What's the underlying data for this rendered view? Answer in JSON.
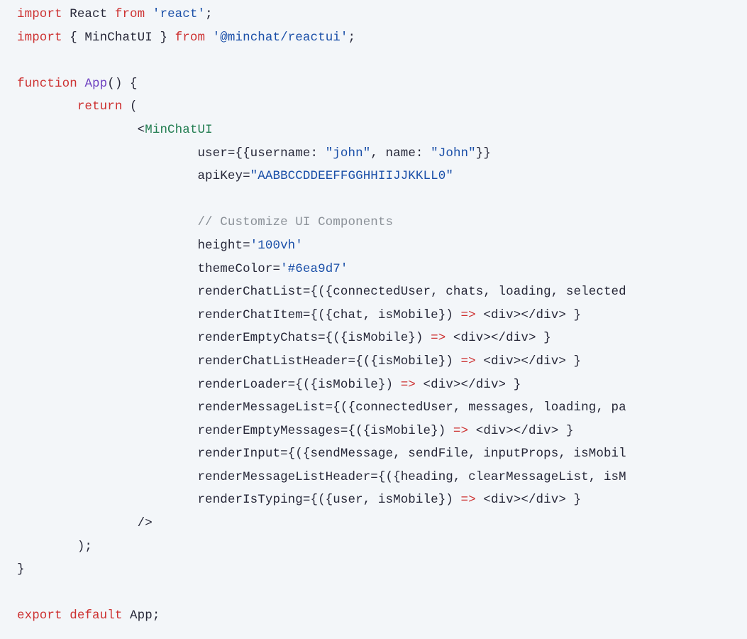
{
  "code": {
    "l1_import": "import",
    "l1_React": " React ",
    "l1_from": "from",
    "l1_str": " 'react'",
    "l1_semi": ";",
    "l2_import": "import",
    "l2_brace": " { MinChatUI } ",
    "l2_from": "from",
    "l2_str": " '@minchat/reactui'",
    "l2_semi": ";",
    "blank": "",
    "l4_function": "function",
    "l4_space": " ",
    "l4_App": "App",
    "l4_rest": "() {",
    "l5_indent": "        ",
    "l5_return": "return",
    "l5_rest": " (",
    "l6_indent": "                ",
    "l6_lt": "<",
    "l6_tag": "MinChatUI",
    "propIndent": "                        ",
    "p_user_a": "user={{username: ",
    "p_user_s1": "\"john\"",
    "p_user_b": ", name: ",
    "p_user_s2": "\"John\"",
    "p_user_c": "}}",
    "p_apiKey_a": "apiKey=",
    "p_apiKey_s": "\"AABBCCDDEEFFGGHHIIJJKKLL0\"",
    "p_comment": "// Customize UI Components",
    "p_height_a": "height=",
    "p_height_s": "'100vh'",
    "p_theme_a": "themeColor=",
    "p_theme_s": "'#6ea9d7'",
    "p_rcl": "renderChatList={({connectedUser, chats, loading, selected",
    "p_rci_a": "renderChatItem={({chat, isMobile}) ",
    "p_arrow": "=>",
    "p_divexp": " <div></div> }",
    "p_rec_a": "renderEmptyChats={({isMobile}) ",
    "p_rclh_a": "renderChatListHeader={({isMobile}) ",
    "p_rl_a": "renderLoader={({isMobile}) ",
    "p_rml": "renderMessageList={({connectedUser, messages, loading, pa",
    "p_rem_a": "renderEmptyMessages={({isMobile}) ",
    "p_ri": "renderInput={({sendMessage, sendFile, inputProps, isMobil",
    "p_rmlh": "renderMessageListHeader={({heading, clearMessageList, isM",
    "p_rit_a": "renderIsTyping={({user, isMobile}) ",
    "l_close1_indent": "                ",
    "l_close1": "/>",
    "l_close2_indent": "        ",
    "l_close2": ");",
    "l_close3": "}",
    "l_exp_export": "export",
    "l_exp_default": " default",
    "l_exp_rest": " App;"
  }
}
